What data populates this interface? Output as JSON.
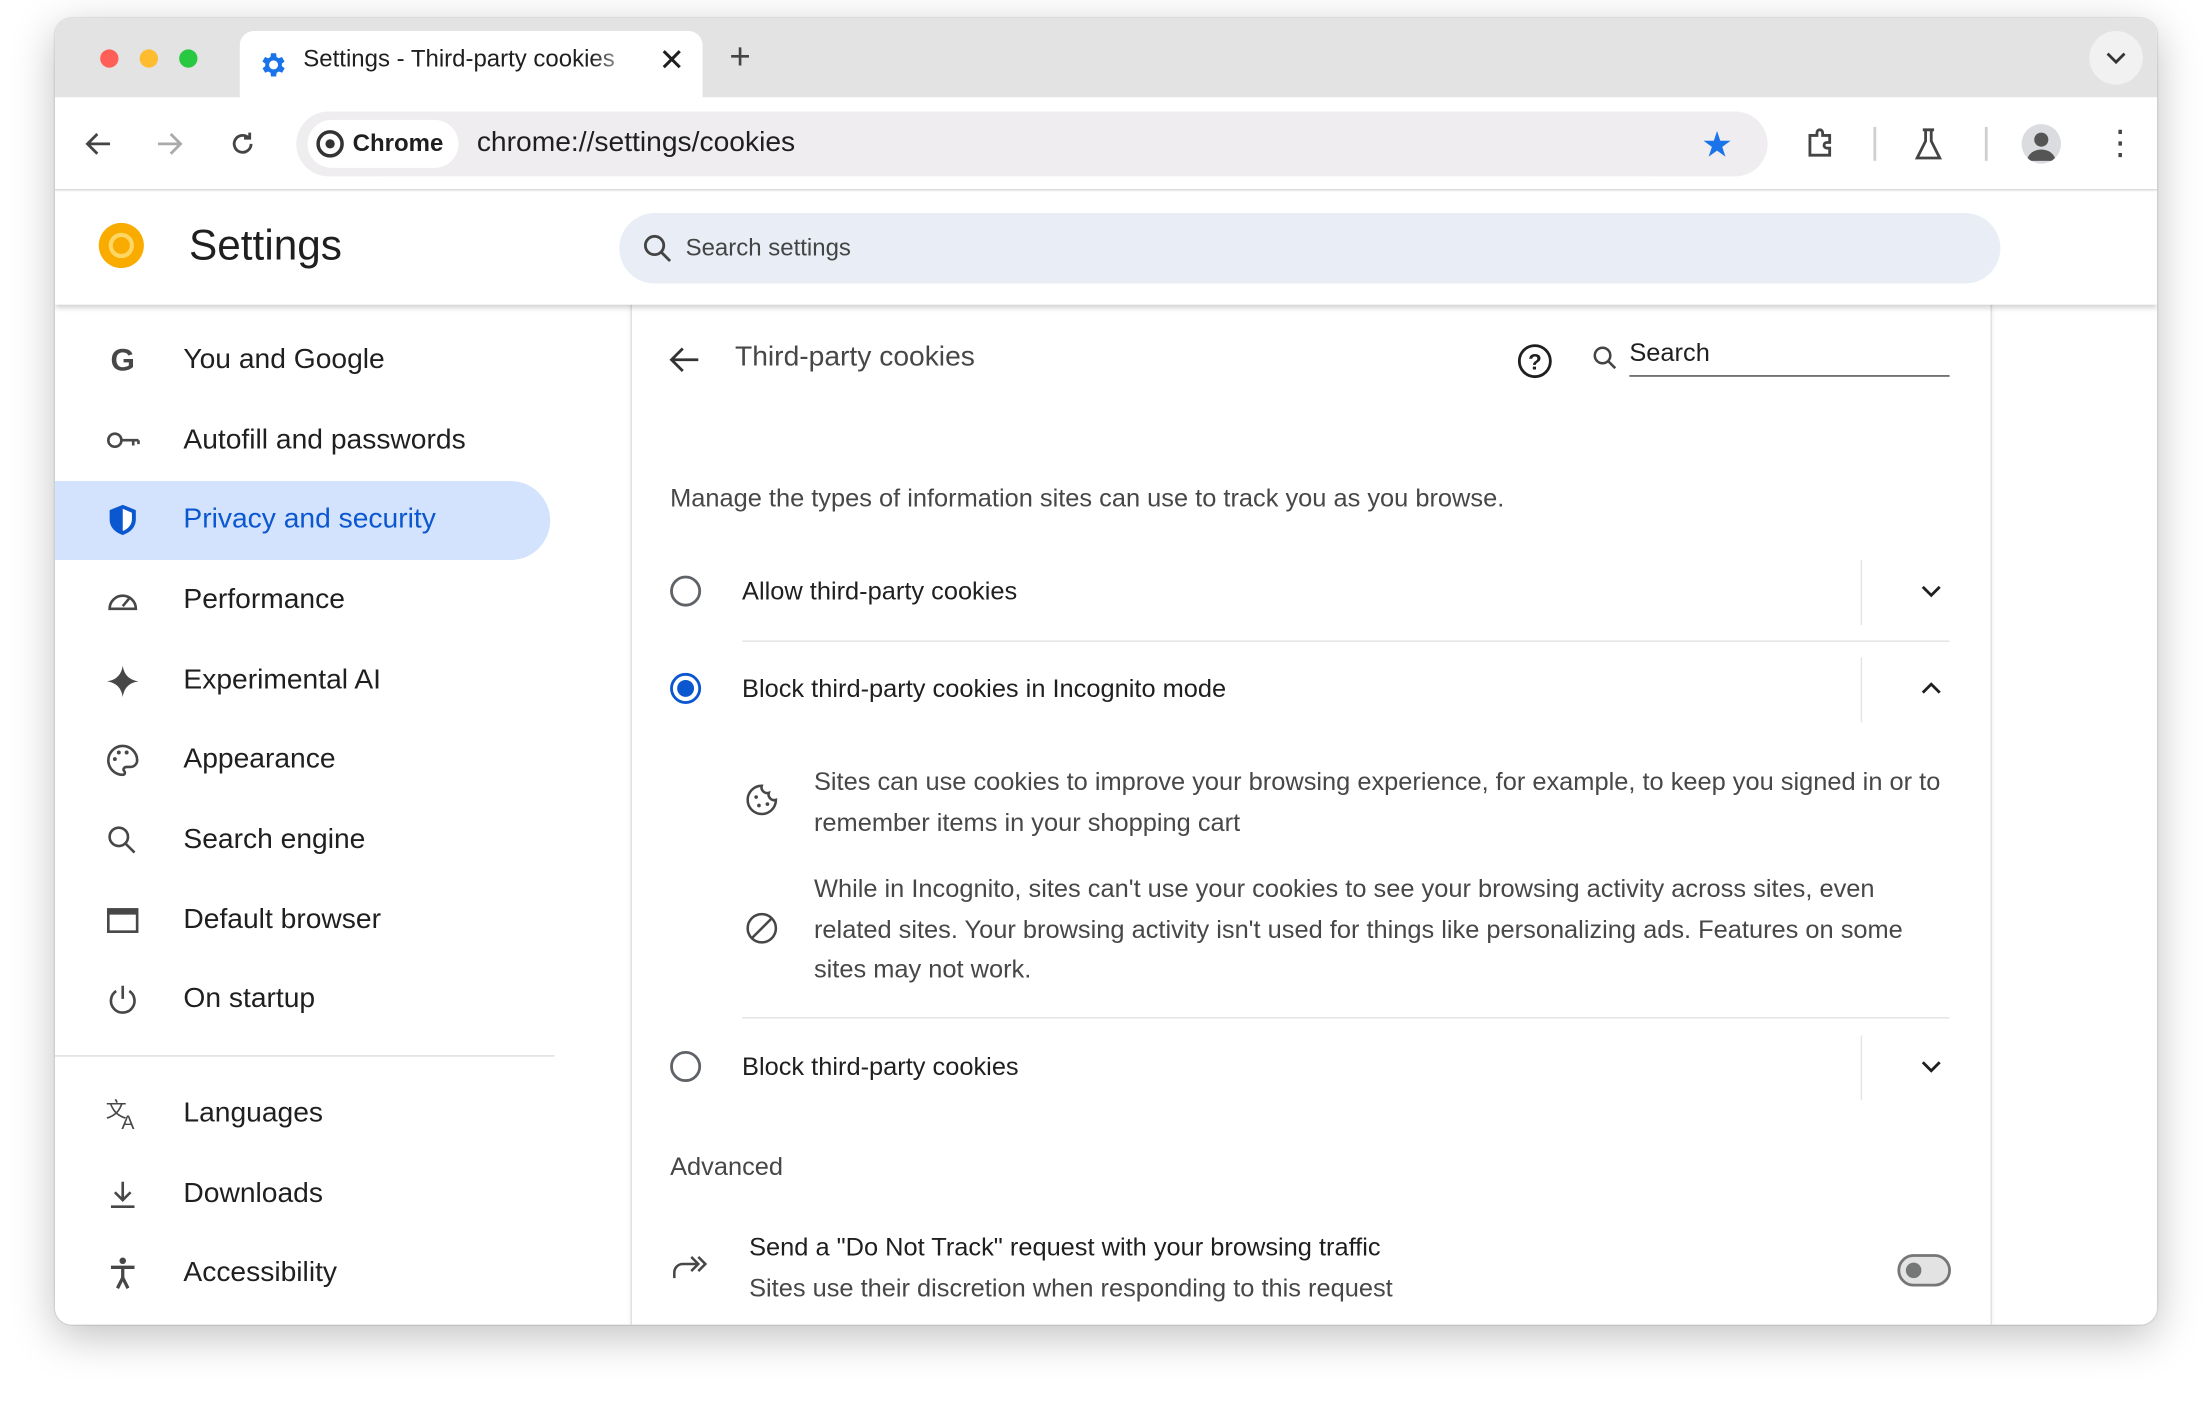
{
  "browser": {
    "tab_title": "Settings - Third-party cookies",
    "omnibox_chip": "Chrome",
    "url": "chrome://settings/cookies",
    "accent": "#0b57d0"
  },
  "header": {
    "title": "Settings",
    "search_placeholder": "Search settings"
  },
  "sidebar": {
    "items": [
      {
        "label": "You and Google",
        "icon": "google-g-icon"
      },
      {
        "label": "Autofill and passwords",
        "icon": "key-icon"
      },
      {
        "label": "Privacy and security",
        "icon": "shield-icon",
        "active": true
      },
      {
        "label": "Performance",
        "icon": "speedometer-icon"
      },
      {
        "label": "Experimental AI",
        "icon": "sparkle-icon"
      },
      {
        "label": "Appearance",
        "icon": "palette-icon"
      },
      {
        "label": "Search engine",
        "icon": "search-icon"
      },
      {
        "label": "Default browser",
        "icon": "browser-window-icon"
      },
      {
        "label": "On startup",
        "icon": "power-icon"
      },
      {
        "label": "Languages",
        "icon": "translate-icon"
      },
      {
        "label": "Downloads",
        "icon": "download-icon"
      },
      {
        "label": "Accessibility",
        "icon": "accessibility-icon"
      }
    ]
  },
  "page": {
    "title": "Third-party cookies",
    "search_placeholder": "Search",
    "description": "Manage the types of information sites can use to track you as you browse.",
    "options": [
      {
        "label": "Allow third-party cookies",
        "selected": false,
        "expanded": false
      },
      {
        "label": "Block third-party cookies in Incognito mode",
        "selected": true,
        "expanded": true,
        "details": [
          "Sites can use cookies to improve your browsing experience, for example, to keep you signed in or to remember items in your shopping cart",
          "While in Incognito, sites can't use your cookies to see your browsing activity across sites, even related sites. Your browsing activity isn't used for things like personalizing ads. Features on some sites may not work."
        ]
      },
      {
        "label": "Block third-party cookies",
        "selected": false,
        "expanded": false
      }
    ],
    "advanced_heading": "Advanced",
    "dnt": {
      "title": "Send a \"Do Not Track\" request with your browsing traffic",
      "subtitle": "Sites use their discretion when responding to this request",
      "enabled": false
    }
  }
}
